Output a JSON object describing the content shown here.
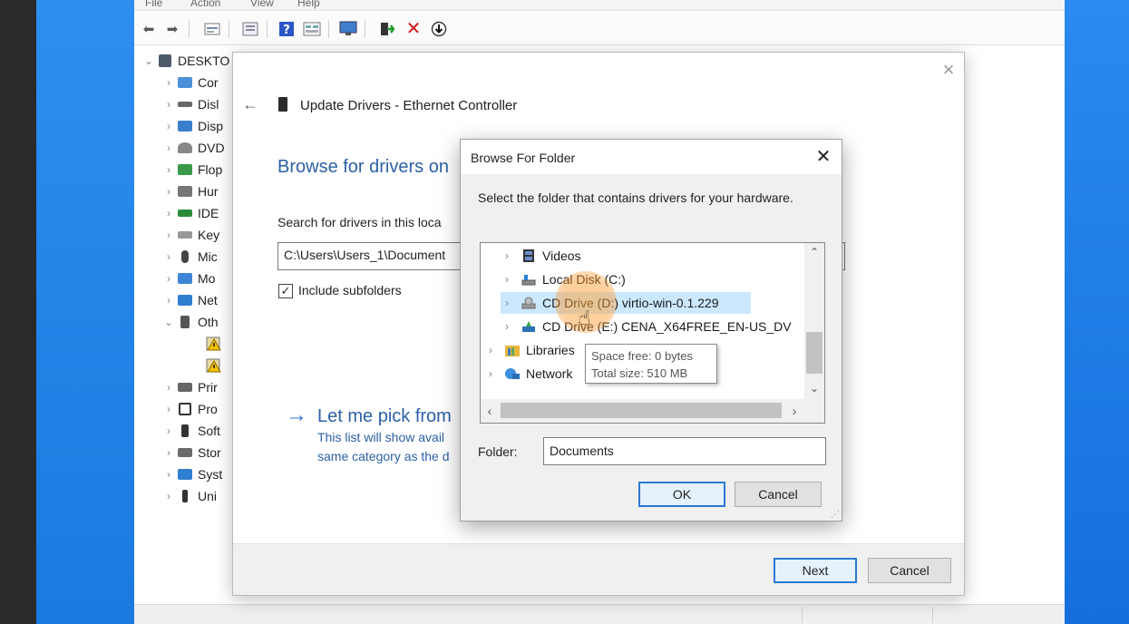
{
  "device_manager": {
    "menu": [
      "File",
      "Action",
      "View",
      "Help"
    ],
    "toolbar_icons": [
      "back-arrow-icon",
      "forward-arrow-icon",
      "properties-icon",
      "list-view-icon",
      "help-icon",
      "details-icon",
      "monitor-icon",
      "update-driver-icon",
      "uninstall-icon",
      "scan-hardware-icon"
    ],
    "tree": {
      "root": "DESKTO",
      "items": [
        {
          "label": "Cor",
          "icon": "computer-icon"
        },
        {
          "label": "Disl",
          "icon": "disk-drive-icon"
        },
        {
          "label": "Disp",
          "icon": "display-adapter-icon"
        },
        {
          "label": "DVD",
          "icon": "dvd-drive-icon"
        },
        {
          "label": "Flop",
          "icon": "floppy-icon"
        },
        {
          "label": "Hur",
          "icon": "human-interface-icon"
        },
        {
          "label": "IDE",
          "icon": "ide-controller-icon"
        },
        {
          "label": "Key",
          "icon": "keyboard-icon"
        },
        {
          "label": "Mic",
          "icon": "mouse-icon"
        },
        {
          "label": "Mo",
          "icon": "monitor-icon"
        },
        {
          "label": "Net",
          "icon": "network-adapter-icon"
        },
        {
          "label": "Oth",
          "icon": "other-devices-icon"
        },
        {
          "label": "Prir",
          "icon": "print-queue-icon"
        },
        {
          "label": "Pro",
          "icon": "processor-icon"
        },
        {
          "label": "Soft",
          "icon": "software-device-icon"
        },
        {
          "label": "Stor",
          "icon": "storage-controller-icon"
        },
        {
          "label": "Syst",
          "icon": "system-device-icon"
        },
        {
          "label": "Uni",
          "icon": "usb-controller-icon"
        }
      ]
    }
  },
  "wizard": {
    "title": "Update Drivers - Ethernet Controller",
    "heading": "Browse for drivers on",
    "search_label": "Search for drivers in this loca",
    "path_value": "C:\\Users\\Users_1\\Document",
    "include_subfolders_label": "Include subfolders",
    "include_subfolders_checked": "✓",
    "pick_link": "Let me pick from",
    "pick_desc_line1": "This list will show avail",
    "pick_desc_line2": "same category as the d",
    "next_label": "Next",
    "cancel_label": "Cancel"
  },
  "browse_dialog": {
    "title": "Browse For Folder",
    "close_glyph": "✕",
    "description": "Select the folder that contains drivers for your hardware.",
    "folders": [
      {
        "label": "Videos",
        "icon": "videos-folder-icon"
      },
      {
        "label": "Local Disk (C:)",
        "icon": "local-disk-icon"
      },
      {
        "label": "CD Drive (D:) virtio-win-0.1.229",
        "icon": "cd-drive-icon"
      },
      {
        "label": "CD Drive (E:) CENA_X64FREE_EN-US_DV",
        "icon": "cd-drive-setup-icon"
      },
      {
        "label": "Libraries",
        "icon": "libraries-icon"
      },
      {
        "label": "Network",
        "icon": "network-icon"
      }
    ],
    "tooltip_line1": "Space free: 0 bytes",
    "tooltip_line2": "Total size: 510 MB",
    "folder_label": "Folder:",
    "folder_value": "Documents",
    "ok_label": "OK",
    "cancel_label": "Cancel"
  }
}
